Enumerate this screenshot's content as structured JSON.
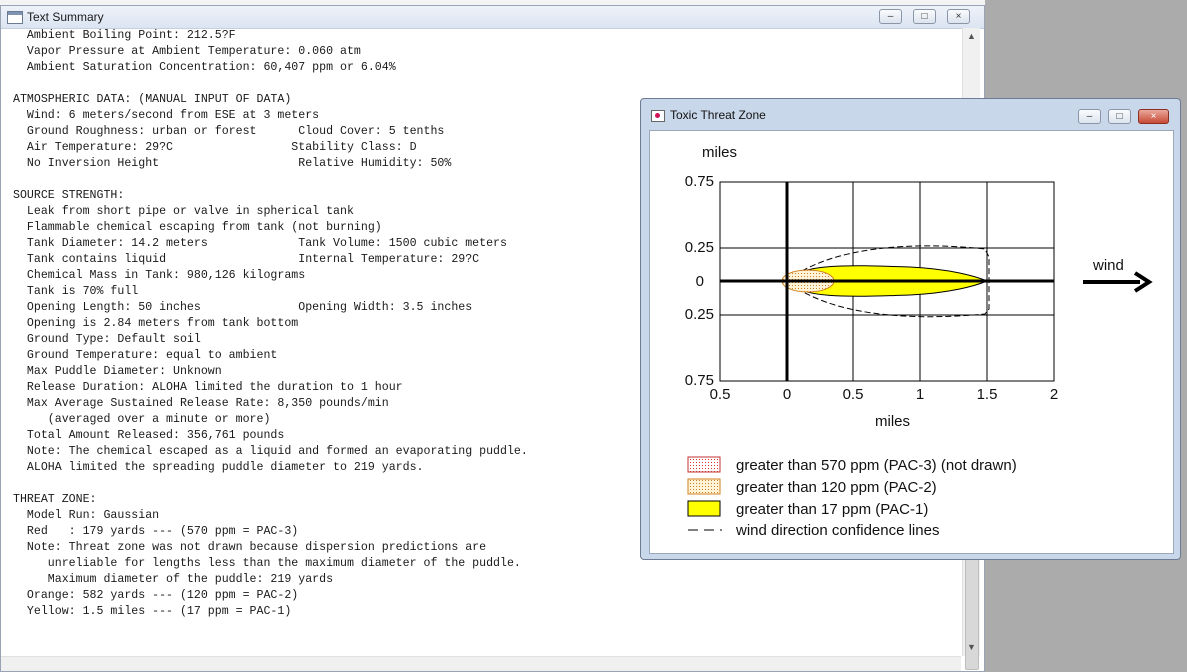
{
  "text_window": {
    "title": "Text Summary",
    "lines": [
      "  Ambient Boiling Point: 212.5?F",
      "  Vapor Pressure at Ambient Temperature: 0.060 atm",
      "  Ambient Saturation Concentration: 60,407 ppm or 6.04%",
      "",
      "ATMOSPHERIC DATA: (MANUAL INPUT OF DATA)",
      "  Wind: 6 meters/second from ESE at 3 meters",
      "  Ground Roughness: urban or forest      Cloud Cover: 5 tenths",
      "  Air Temperature: 29?C                 Stability Class: D",
      "  No Inversion Height                    Relative Humidity: 50%",
      "",
      "SOURCE STRENGTH:",
      "  Leak from short pipe or valve in spherical tank",
      "  Flammable chemical escaping from tank (not burning)",
      "  Tank Diameter: 14.2 meters             Tank Volume: 1500 cubic meters",
      "  Tank contains liquid                   Internal Temperature: 29?C",
      "  Chemical Mass in Tank: 980,126 kilograms",
      "  Tank is 70% full",
      "  Opening Length: 50 inches              Opening Width: 3.5 inches",
      "  Opening is 2.84 meters from tank bottom",
      "  Ground Type: Default soil",
      "  Ground Temperature: equal to ambient",
      "  Max Puddle Diameter: Unknown",
      "  Release Duration: ALOHA limited the duration to 1 hour",
      "  Max Average Sustained Release Rate: 8,350 pounds/min",
      "     (averaged over a minute or more)",
      "  Total Amount Released: 356,761 pounds",
      "  Note: The chemical escaped as a liquid and formed an evaporating puddle.",
      "  ALOHA limited the spreading puddle diameter to 219 yards.",
      "",
      "THREAT ZONE:",
      "  Model Run: Gaussian",
      "  Red   : 179 yards --- (570 ppm = PAC-3)",
      "  Note: Threat zone was not drawn because dispersion predictions are",
      "     unreliable for lengths less than the maximum diameter of the puddle.",
      "     Maximum diameter of the puddle: 219 yards",
      "  Orange: 582 yards --- (120 ppm = PAC-2)",
      "  Yellow: 1.5 miles --- (17 ppm = PAC-1)"
    ]
  },
  "threat_window": {
    "title": "Toxic Threat Zone",
    "y_unit_label": "miles",
    "x_unit_label": "miles",
    "y_tick_labels": [
      "0.75",
      "0.25",
      "0",
      "0.25",
      "0.75"
    ],
    "x_tick_labels": [
      "0.5",
      "0",
      "0.5",
      "1",
      "1.5",
      "2"
    ],
    "wind_label": "wind",
    "legend": [
      {
        "label": "greater than 570 ppm (PAC-3) (not drawn)",
        "swatch": "red-dotted"
      },
      {
        "label": "greater than 120 ppm (PAC-2)",
        "swatch": "orange-dotted"
      },
      {
        "label": "greater than 17 ppm (PAC-1)",
        "swatch": "yellow"
      },
      {
        "label": "wind direction confidence lines",
        "swatch": "dashed"
      }
    ]
  },
  "colors": {
    "pac1_yellow": "#ffff00",
    "pac2_orange": "#f0a030",
    "pac3_red": "#e03030",
    "window_frame": "#c9d7ea"
  }
}
